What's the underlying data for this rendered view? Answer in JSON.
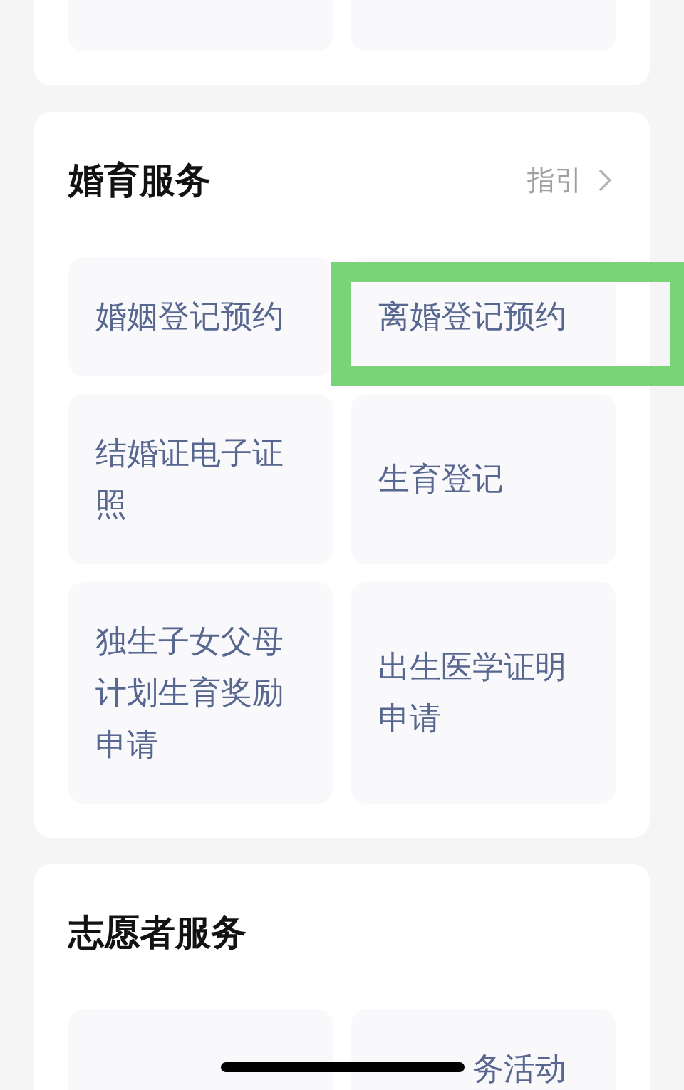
{
  "sections": [
    {
      "tiles": [
        {
          "kind": "cut_off",
          "highlighted": false
        },
        {
          "kind": "cut_off",
          "highlighted": false
        }
      ]
    },
    {
      "title": "婚育服务",
      "guide_link": {
        "label": "指引"
      },
      "tiles": [
        {
          "kind": "text",
          "label": "婚姻登记预约",
          "highlighted": false
        },
        {
          "kind": "text",
          "label": "离婚登记预约",
          "highlighted": true
        },
        {
          "kind": "text",
          "label": "结婚证电子证照",
          "highlighted": false
        },
        {
          "kind": "text",
          "label": "生育登记",
          "highlighted": false
        },
        {
          "kind": "text",
          "label": "独生子女父母计划生育奖励申请",
          "highlighted": false
        },
        {
          "kind": "text",
          "label": "出生医学证明申请",
          "highlighted": false
        }
      ]
    },
    {
      "title": "志愿者服务",
      "tiles": [
        {
          "kind": "cut_off",
          "highlighted": false
        },
        {
          "kind": "partly_covered",
          "label": "务活动",
          "highlighted": false
        }
      ]
    }
  ]
}
